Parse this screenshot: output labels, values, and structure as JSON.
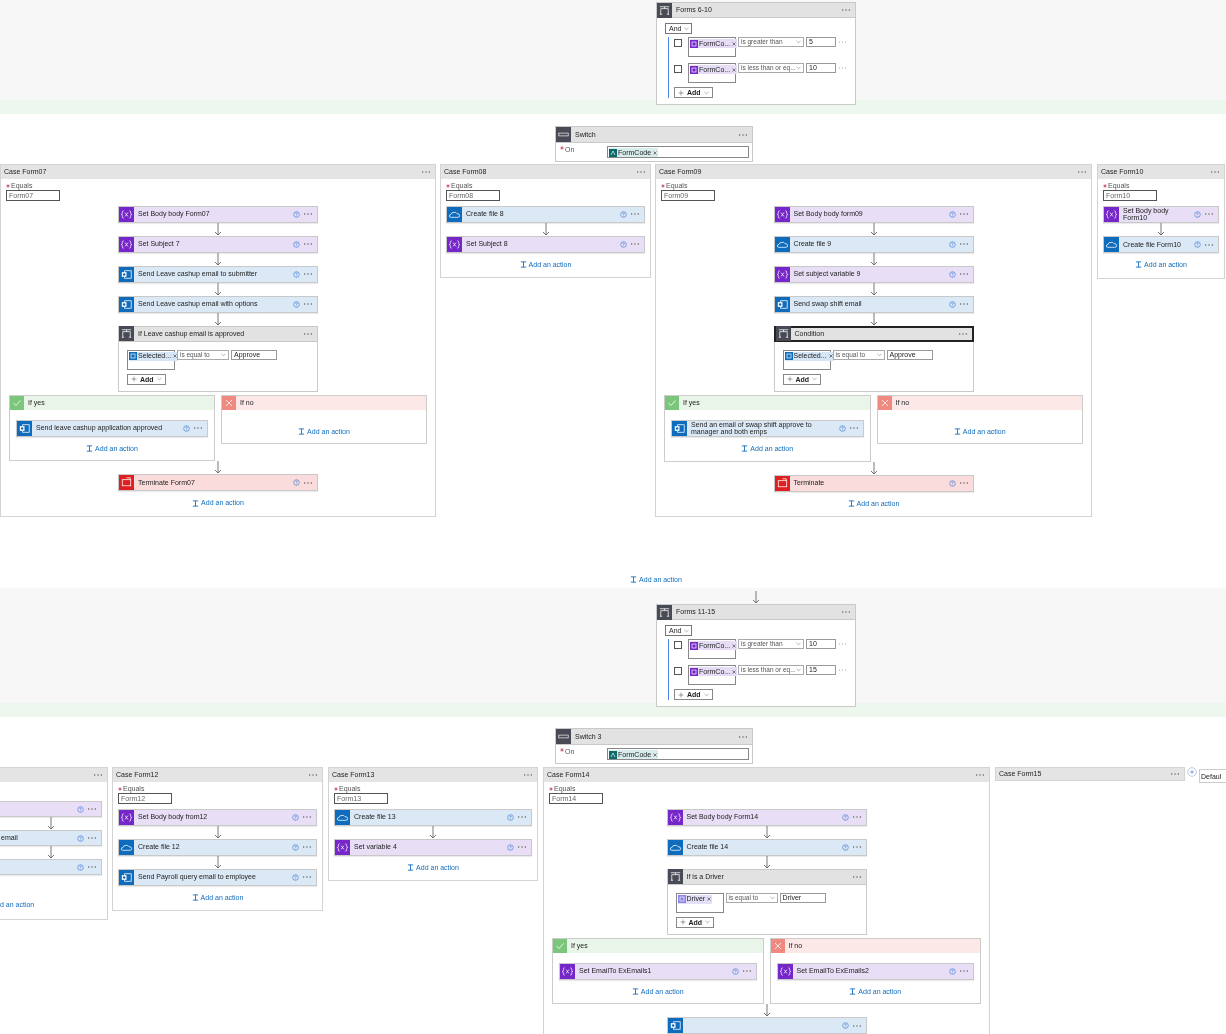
{
  "top_condition": {
    "title": "Forms 6-10",
    "group": "And",
    "rows": [
      {
        "kind": "variable",
        "token": "FormCo...",
        "operator": "is greater than",
        "value": "5",
        "checked": false
      },
      {
        "kind": "variable",
        "token": "FormCo...",
        "operator": "is less than or eq...",
        "value": "10",
        "checked": false
      }
    ],
    "add_label": "Add"
  },
  "switch": {
    "title": "Switch",
    "field_label": "On",
    "required": true,
    "token": "FormCode"
  },
  "cases_row_1": [
    {
      "kind": "case",
      "title": "Case Form07",
      "equals_label": "Equals",
      "required": true,
      "equals_value": "Form07",
      "add_label": "Add an action",
      "steps": [
        {
          "kind": "variable",
          "title": "Set Body body Form07"
        },
        {
          "kind": "variable",
          "title": "Set Subject 7"
        },
        {
          "kind": "email",
          "title": "Send Leave cashup email to submitter"
        },
        {
          "kind": "email",
          "title": "Send Leave cashup email with options"
        },
        {
          "kind": "condition",
          "title": "If Leave cashup email is approved",
          "selected": false,
          "rows": [
            {
              "kind": "email",
              "token": "Selected...",
              "operator": "is equal to",
              "value": "Approve"
            }
          ],
          "add_label": "Add"
        },
        {
          "kind": "branches",
          "yes": {
            "label": "If yes",
            "add_label": "Add an action",
            "steps": [
              {
                "kind": "email",
                "title": "Send leave cashup application approved"
              }
            ]
          },
          "no": {
            "label": "If no",
            "add_label": "Add an action"
          }
        },
        {
          "kind": "terminate",
          "title": "Terminate Form07"
        }
      ]
    },
    {
      "kind": "case",
      "title": "Case Form08",
      "equals_label": "Equals",
      "required": true,
      "equals_value": "Form08",
      "add_label": "Add an action",
      "steps": [
        {
          "kind": "file",
          "title": "Create file 8"
        },
        {
          "kind": "variable",
          "title": "Set Subject 8"
        }
      ]
    },
    {
      "kind": "case",
      "title": "Case Form09",
      "equals_label": "Equals",
      "required": true,
      "equals_value": "Form09",
      "add_label": "Add an action",
      "steps": [
        {
          "kind": "variable",
          "title": "Set Body body form09"
        },
        {
          "kind": "file",
          "title": "Create file 9"
        },
        {
          "kind": "variable",
          "title": "Set subject variable 9"
        },
        {
          "kind": "email",
          "title": "Send swap shift email"
        },
        {
          "kind": "condition",
          "title": "Condition",
          "selected": true,
          "rows": [
            {
              "kind": "email",
              "token": "Selected...",
              "operator": "is equal to",
              "value": "Approve"
            }
          ],
          "add_label": "Add"
        },
        {
          "kind": "branches",
          "yes": {
            "label": "If yes",
            "add_label": "Add an action",
            "steps": [
              {
                "kind": "email",
                "title": "Send an email of swap shift approve to manager and both emps"
              }
            ]
          },
          "no": {
            "label": "If no",
            "add_label": "Add an action"
          }
        },
        {
          "kind": "terminate",
          "title": "Terminate"
        }
      ]
    },
    {
      "kind": "case",
      "title": "Case Form10",
      "equals_label": "Equals",
      "required": true,
      "equals_value": "Form10",
      "add_label": "Add an action",
      "steps": [
        {
          "kind": "variable",
          "title": "Set Body body Form10"
        },
        {
          "kind": "file",
          "title": "Create file Form10"
        }
      ]
    }
  ],
  "row_1_add_label": "Add an action",
  "middle_condition": {
    "title": "Forms 11-15",
    "group": "And",
    "rows": [
      {
        "kind": "variable",
        "token": "FormCo...",
        "operator": "is greater than",
        "value": "10",
        "checked": false
      },
      {
        "kind": "variable",
        "token": "FormCo...",
        "operator": "is less than or eq...",
        "value": "15",
        "checked": false
      }
    ],
    "add_label": "Add"
  },
  "switch_3": {
    "title": "Switch 3",
    "field_label": "On",
    "required": true,
    "token": "FormCode"
  },
  "cases_row_2": [
    {
      "kind": "cut",
      "add_label": "d an action",
      "steps": [
        {
          "kind": "variable"
        },
        {
          "kind": "email",
          "title": "email"
        },
        {
          "kind": "email"
        }
      ]
    },
    {
      "kind": "case",
      "title": "Case Form12",
      "equals_label": "Equals",
      "required": true,
      "equals_value": "Form12",
      "add_label": "Add an action",
      "steps": [
        {
          "kind": "variable",
          "title": "Set Body body from12"
        },
        {
          "kind": "file",
          "title": "Create file 12"
        },
        {
          "kind": "email",
          "title": "Send Payroll query email to employee"
        }
      ]
    },
    {
      "kind": "case",
      "title": "Case Form13",
      "equals_label": "Equals",
      "required": true,
      "equals_value": "Form13",
      "add_label": "Add an action",
      "steps": [
        {
          "kind": "file",
          "title": "Create file 13"
        },
        {
          "kind": "variable",
          "title": "Set variable 4"
        }
      ]
    },
    {
      "kind": "case",
      "title": "Case Form14",
      "equals_label": "Equals",
      "required": true,
      "equals_value": "Form14",
      "steps": [
        {
          "kind": "variable",
          "title": "Set Body body Form14"
        },
        {
          "kind": "file",
          "title": "Create file 14"
        },
        {
          "kind": "condition",
          "title": "If is a Driver",
          "selected": false,
          "rows": [
            {
              "kind": "driver",
              "token": "Driver",
              "operator": "is equal to",
              "value": "Driver"
            }
          ],
          "add_label": "Add"
        },
        {
          "kind": "branches",
          "yes": {
            "label": "If yes",
            "add_label": "Add an action",
            "steps": [
              {
                "kind": "variable",
                "title": "Set EmailTo ExEmails1"
              }
            ]
          },
          "no": {
            "label": "If no",
            "add_label": "Add an action",
            "steps": [
              {
                "kind": "variable",
                "title": "Set EmailTo ExEmails2"
              }
            ]
          }
        },
        {
          "kind": "email"
        }
      ]
    },
    {
      "kind": "collapsed",
      "title": "Case Form15"
    },
    {
      "kind": "default",
      "title": "Defaul"
    }
  ]
}
